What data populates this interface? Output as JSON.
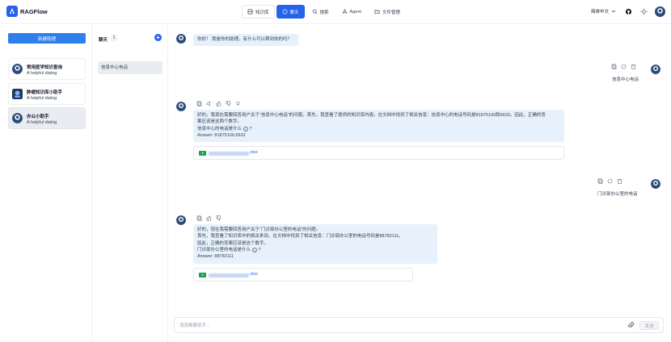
{
  "app": {
    "brand": "RAGFlow"
  },
  "nav": {
    "items": [
      {
        "label": "知识库"
      },
      {
        "label": "聊天"
      },
      {
        "label": "搜索"
      },
      {
        "label": "Agent"
      },
      {
        "label": "文件管理"
      }
    ],
    "active": "聊天"
  },
  "header": {
    "language": "简体中文"
  },
  "sidebar": {
    "new_button": "新建助理",
    "assistants": [
      {
        "name": "常用医学知识查询",
        "desc": "A helpful dialog"
      },
      {
        "name": "肿瘤知识库小助手",
        "desc": "A helpful dialog"
      },
      {
        "name": "办公小助手",
        "desc": "A helpful dialog"
      }
    ]
  },
  "conversations": {
    "title": "聊天",
    "count": "1",
    "items": [
      "信息中心电话"
    ]
  },
  "chat": {
    "greeting": "你好！ 我是你的助理，有什么可以帮到你的吗？",
    "messages": [
      {
        "role": "user",
        "text": "信息中心电话"
      },
      {
        "role": "assistant",
        "lines": [
          "好的，我现在需要回答用户关于“信息中心电话”的问题。首先，我查看了提供的知识库内容。在文档中找到了相关信息：信息中心的电话号码是81875100和6632。因此，正确的答",
          "案应该是这两个数字。",
          "信息中心的电话是什么",
          "Answer: 81875100,6632"
        ],
        "file_ext": ".xlsx"
      },
      {
        "role": "user",
        "text": "门诊部办公室的电话"
      },
      {
        "role": "assistant",
        "lines": [
          "好的，现在我需要回答用户关于“门诊部办公室的电话”的问题。",
          "首先，我查看了知识库中的相关条目。在文档中找到了相关信息：门诊部办公室的电话号码是88782111。",
          "因此，正确的答案应该是这个数字。",
          "门诊部办公室的电话是什么",
          "Answer: 88782111"
        ],
        "file_ext": ".xlsx"
      }
    ],
    "info_icon_label": "?",
    "input_placeholder": "消息概要助手...",
    "send_label": "发送"
  },
  "colors": {
    "accent": "#2563eb",
    "bubble": "#e6f1fb",
    "active_item": "#e9ecf1"
  }
}
